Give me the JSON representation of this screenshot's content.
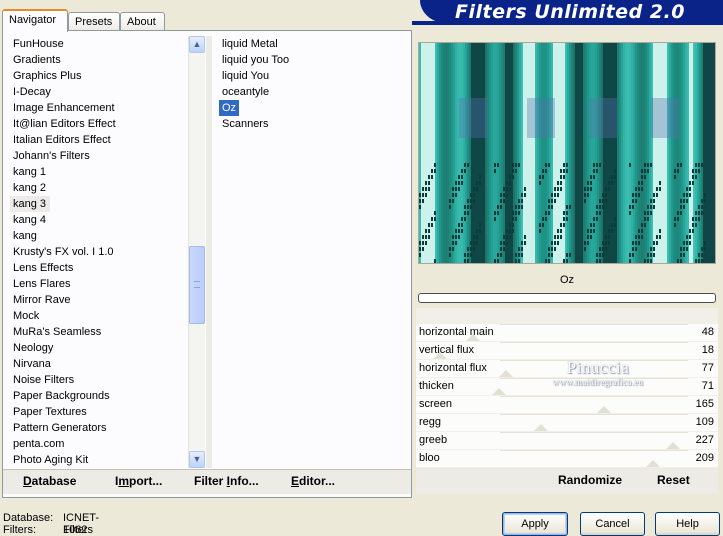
{
  "header": {
    "title": "Filters Unlimited 2.0"
  },
  "tabs": [
    {
      "label": "Navigator",
      "active": true
    },
    {
      "label": "Presets",
      "active": false
    },
    {
      "label": "About",
      "active": false
    }
  ],
  "categories": {
    "selected": "kang 3",
    "items": [
      "FunHouse",
      "Gradients",
      "Graphics Plus",
      "I-Decay",
      "Image Enhancement",
      "It@lian Editors Effect",
      "Italian Editors Effect",
      "Johann's Filters",
      "kang 1",
      "kang 2",
      "kang 3",
      "kang 4",
      "kang",
      "Krusty's FX vol. I 1.0",
      "Lens Effects",
      "Lens Flares",
      "Mirror Rave",
      "Mock",
      "MuRa's Seamless",
      "Neology",
      "Nirvana",
      "Noise Filters",
      "Paper Backgrounds",
      "Paper Textures",
      "Pattern Generators",
      "penta.com",
      "Photo Aging Kit"
    ]
  },
  "filters": {
    "selected": "Oz",
    "items": [
      "liquid Metal",
      "liquid you Too",
      "liquid You",
      "oceantyle",
      "Oz",
      "Scanners"
    ]
  },
  "bottom_buttons": {
    "database": {
      "underlined": "D",
      "rest": "atabase"
    },
    "import": {
      "before": "I",
      "underlined": "m",
      "rest": "port..."
    },
    "filter_info": {
      "before": "Filter ",
      "underlined": "I",
      "rest": "nfo..."
    },
    "editor": {
      "underlined": "E",
      "rest": "ditor..."
    }
  },
  "preview": {
    "filter_name": "Oz",
    "progress": 0
  },
  "parameters": [
    {
      "name": "horizontal main",
      "value": 48
    },
    {
      "name": "vertical flux",
      "value": 18
    },
    {
      "name": "horizontal flux",
      "value": 77
    },
    {
      "name": "thicken",
      "value": 71
    },
    {
      "name": "screen",
      "value": 165
    },
    {
      "name": "regg",
      "value": 109
    },
    {
      "name": "greeb",
      "value": 227
    },
    {
      "name": "bloo",
      "value": 209
    }
  ],
  "watermark": {
    "name": "Pinuccia",
    "site": "www.maidiregrafica.eu"
  },
  "right_buttons": {
    "randomize": "Randomize",
    "reset": "Reset"
  },
  "status": {
    "database_label": "Database:",
    "database_value": "ICNET-Filters",
    "filters_label": "Filters:",
    "filters_value": "1062"
  },
  "dialog": {
    "apply": "Apply",
    "cancel": "Cancel",
    "help": "Help"
  },
  "colors": {
    "banner": "#0a2389",
    "selection": "#316ac5",
    "preview_teal": "#2fb9a8",
    "preview_dark": "#0c3b3c"
  }
}
